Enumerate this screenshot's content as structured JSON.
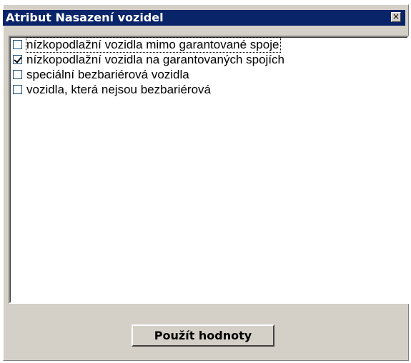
{
  "window": {
    "title": "Atribut Nasazení vozidel",
    "close_glyph": "×"
  },
  "list": {
    "items": [
      {
        "label": "nízkopodlažní vozidla mimo garantované spoje",
        "checked": false
      },
      {
        "label": "nízkopodlažní vozidla na garantovaných spojích",
        "checked": true
      },
      {
        "label": "speciální bezbariérová vozidla",
        "checked": false
      },
      {
        "label": "vozidla, která nejsou bezbariérová",
        "checked": false
      }
    ]
  },
  "footer": {
    "apply_label": "Použít hodnoty"
  },
  "colors": {
    "titlebar": "#0a246a",
    "face": "#d4d0c8"
  }
}
